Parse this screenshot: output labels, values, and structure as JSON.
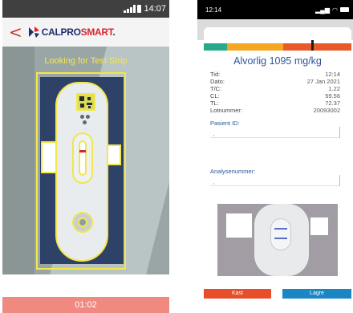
{
  "left_screen": {
    "status": {
      "time": "14:07"
    },
    "appbar": {
      "back": "<",
      "logo_text_1": "CALPRO",
      "logo_text_2": "SMART",
      "logo_text_3": "."
    },
    "camera": {
      "prompt": "Looking for Test Strip"
    },
    "footer": {
      "timer": "01:02"
    },
    "colors": {
      "guide": "#f2e64a",
      "footer": "#f08a80",
      "brand_red": "#d8252e",
      "brand_blue": "#1c2f6b"
    }
  },
  "right_screen": {
    "status": {
      "time": "12:14"
    },
    "severity_bar": {
      "segments": [
        {
          "color": "#2aa88c",
          "weight": 16
        },
        {
          "color": "#f5a623",
          "weight": 38
        },
        {
          "color": "#e85a2a",
          "weight": 46
        }
      ],
      "marker_fraction": 0.73
    },
    "result_label": "Alvorlig 1095 mg/kg",
    "details": [
      {
        "label": "Tid:",
        "value": "12:14"
      },
      {
        "label": "Dato:",
        "value": "27 Jan 2021"
      },
      {
        "label": "T/C:",
        "value": "1.22"
      },
      {
        "label": "CL:",
        "value": "59.56"
      },
      {
        "label": "TL:",
        "value": "72.37"
      },
      {
        "label": "Lotnummer:",
        "value": "20093002"
      }
    ],
    "patient_id_label": "Pasient ID:",
    "analysis_number_label": "Analysenummer:",
    "buttons": {
      "discard": "Kast",
      "save": "Lagre"
    },
    "colors": {
      "accent": "#2f5597",
      "discard": "#e84e2a",
      "save": "#1b86c4"
    }
  }
}
